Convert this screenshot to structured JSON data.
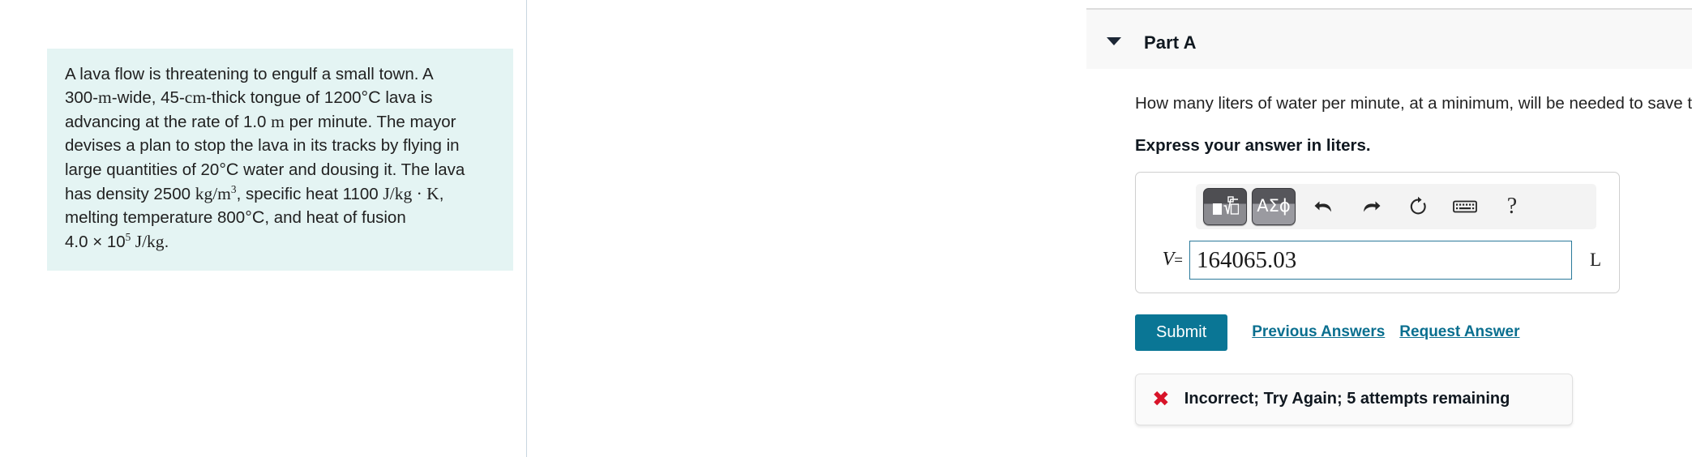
{
  "problem": {
    "line1": "A lava flow is threatening to engulf a small town. A",
    "line2_pre": "300-",
    "line2_m": "m",
    "line2_mid": "-wide, 45-",
    "line2_cm": "cm",
    "line2_mid2": "-thick tongue of 1200",
    "line2_degC": "°C",
    "line2_end": " lava is",
    "line3_pre": "advancing at the rate of 1.0 ",
    "line3_m": "m",
    "line3_end": " per minute. The mayor",
    "line4": "devises a plan to stop the lava in its tracks by flying in",
    "line5_pre": "large quantities of 20",
    "line5_degC": "°C",
    "line5_end": " water and dousing it. The lava",
    "line6_pre": "has density 2500 ",
    "line6_density": "kg/m",
    "line6_density_exp": "3",
    "line6_mid": ", specific heat 1100 ",
    "line6_cp": "J/kg · K",
    "line6_end": ",",
    "line7_pre": "melting temperature 800",
    "line7_degC": "°C",
    "line7_end": ", and heat of fusion",
    "line8_value": "4.0 × 10",
    "line8_exp": "5",
    "line8_unit": " J/kg",
    "line8_end": "."
  },
  "part": {
    "title": "Part A",
    "caret_icon": "caret-down-icon"
  },
  "main": {
    "question": "How many liters of water per minute, at a minimum, will be needed to save the town?",
    "instruction": "Express your answer in liters."
  },
  "toolbar": {
    "template_icon": "math-template-icon",
    "greek_label": "ΑΣϕ",
    "undo_icon": "undo-arrow-icon",
    "redo_icon": "redo-arrow-icon",
    "reset_icon": "reset-refresh-icon",
    "keyboard_icon": "keyboard-icon",
    "help_label": "?"
  },
  "answer": {
    "variable": "V",
    "equals": "=",
    "value": "164065.03",
    "placeholder": "",
    "unit": "L"
  },
  "actions": {
    "submit_label": "Submit",
    "previous_answers_label": "Previous Answers",
    "request_answer_label": "Request Answer"
  },
  "feedback": {
    "icon": "x-mark-icon",
    "icon_glyph": "✖",
    "message": "Incorrect; Try Again; 5 attempts remaining"
  },
  "colors": {
    "accent": "#0a7695",
    "link": "#0a6f8f",
    "error": "#d81429",
    "problem_bg": "#e4f4f3",
    "header_bg": "#f8f8f8"
  }
}
